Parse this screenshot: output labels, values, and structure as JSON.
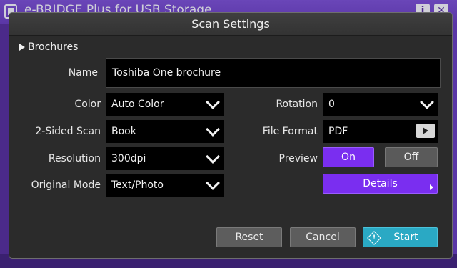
{
  "app": {
    "title": "e-BRIDGE Plus for USB Storage",
    "info_icon_glyph": "i",
    "close_icon_glyph": "✕"
  },
  "dialog": {
    "title": "Scan Settings",
    "breadcrumb": "Brochures"
  },
  "form": {
    "name_label": "Name",
    "name_value": "Toshiba One brochure",
    "color_label": "Color",
    "color_value": "Auto Color",
    "sided_label": "2-Sided Scan",
    "sided_value": "Book",
    "resolution_label": "Resolution",
    "resolution_value": "300dpi",
    "mode_label": "Original Mode",
    "mode_value": "Text/Photo",
    "rotation_label": "Rotation",
    "rotation_value": "0",
    "format_label": "File Format",
    "format_value": "PDF",
    "preview_label": "Preview",
    "preview_on": "On",
    "preview_off": "Off",
    "preview_selected": "On",
    "details_label": "Details"
  },
  "footer": {
    "reset_label": "Reset",
    "cancel_label": "Cancel",
    "start_label": "Start"
  },
  "colors": {
    "accent": "#7a2ef0",
    "start": "#2aa9c4",
    "background_app": "#4b2a8a"
  },
  "icons": {
    "logo": "usb-storage-icon",
    "info": "info-icon",
    "close": "close-icon",
    "breadcrumb": "triangle-right-icon",
    "dropdown": "chevron-down-icon",
    "file_format": "play-right-icon",
    "start": "start-diamond-icon"
  }
}
